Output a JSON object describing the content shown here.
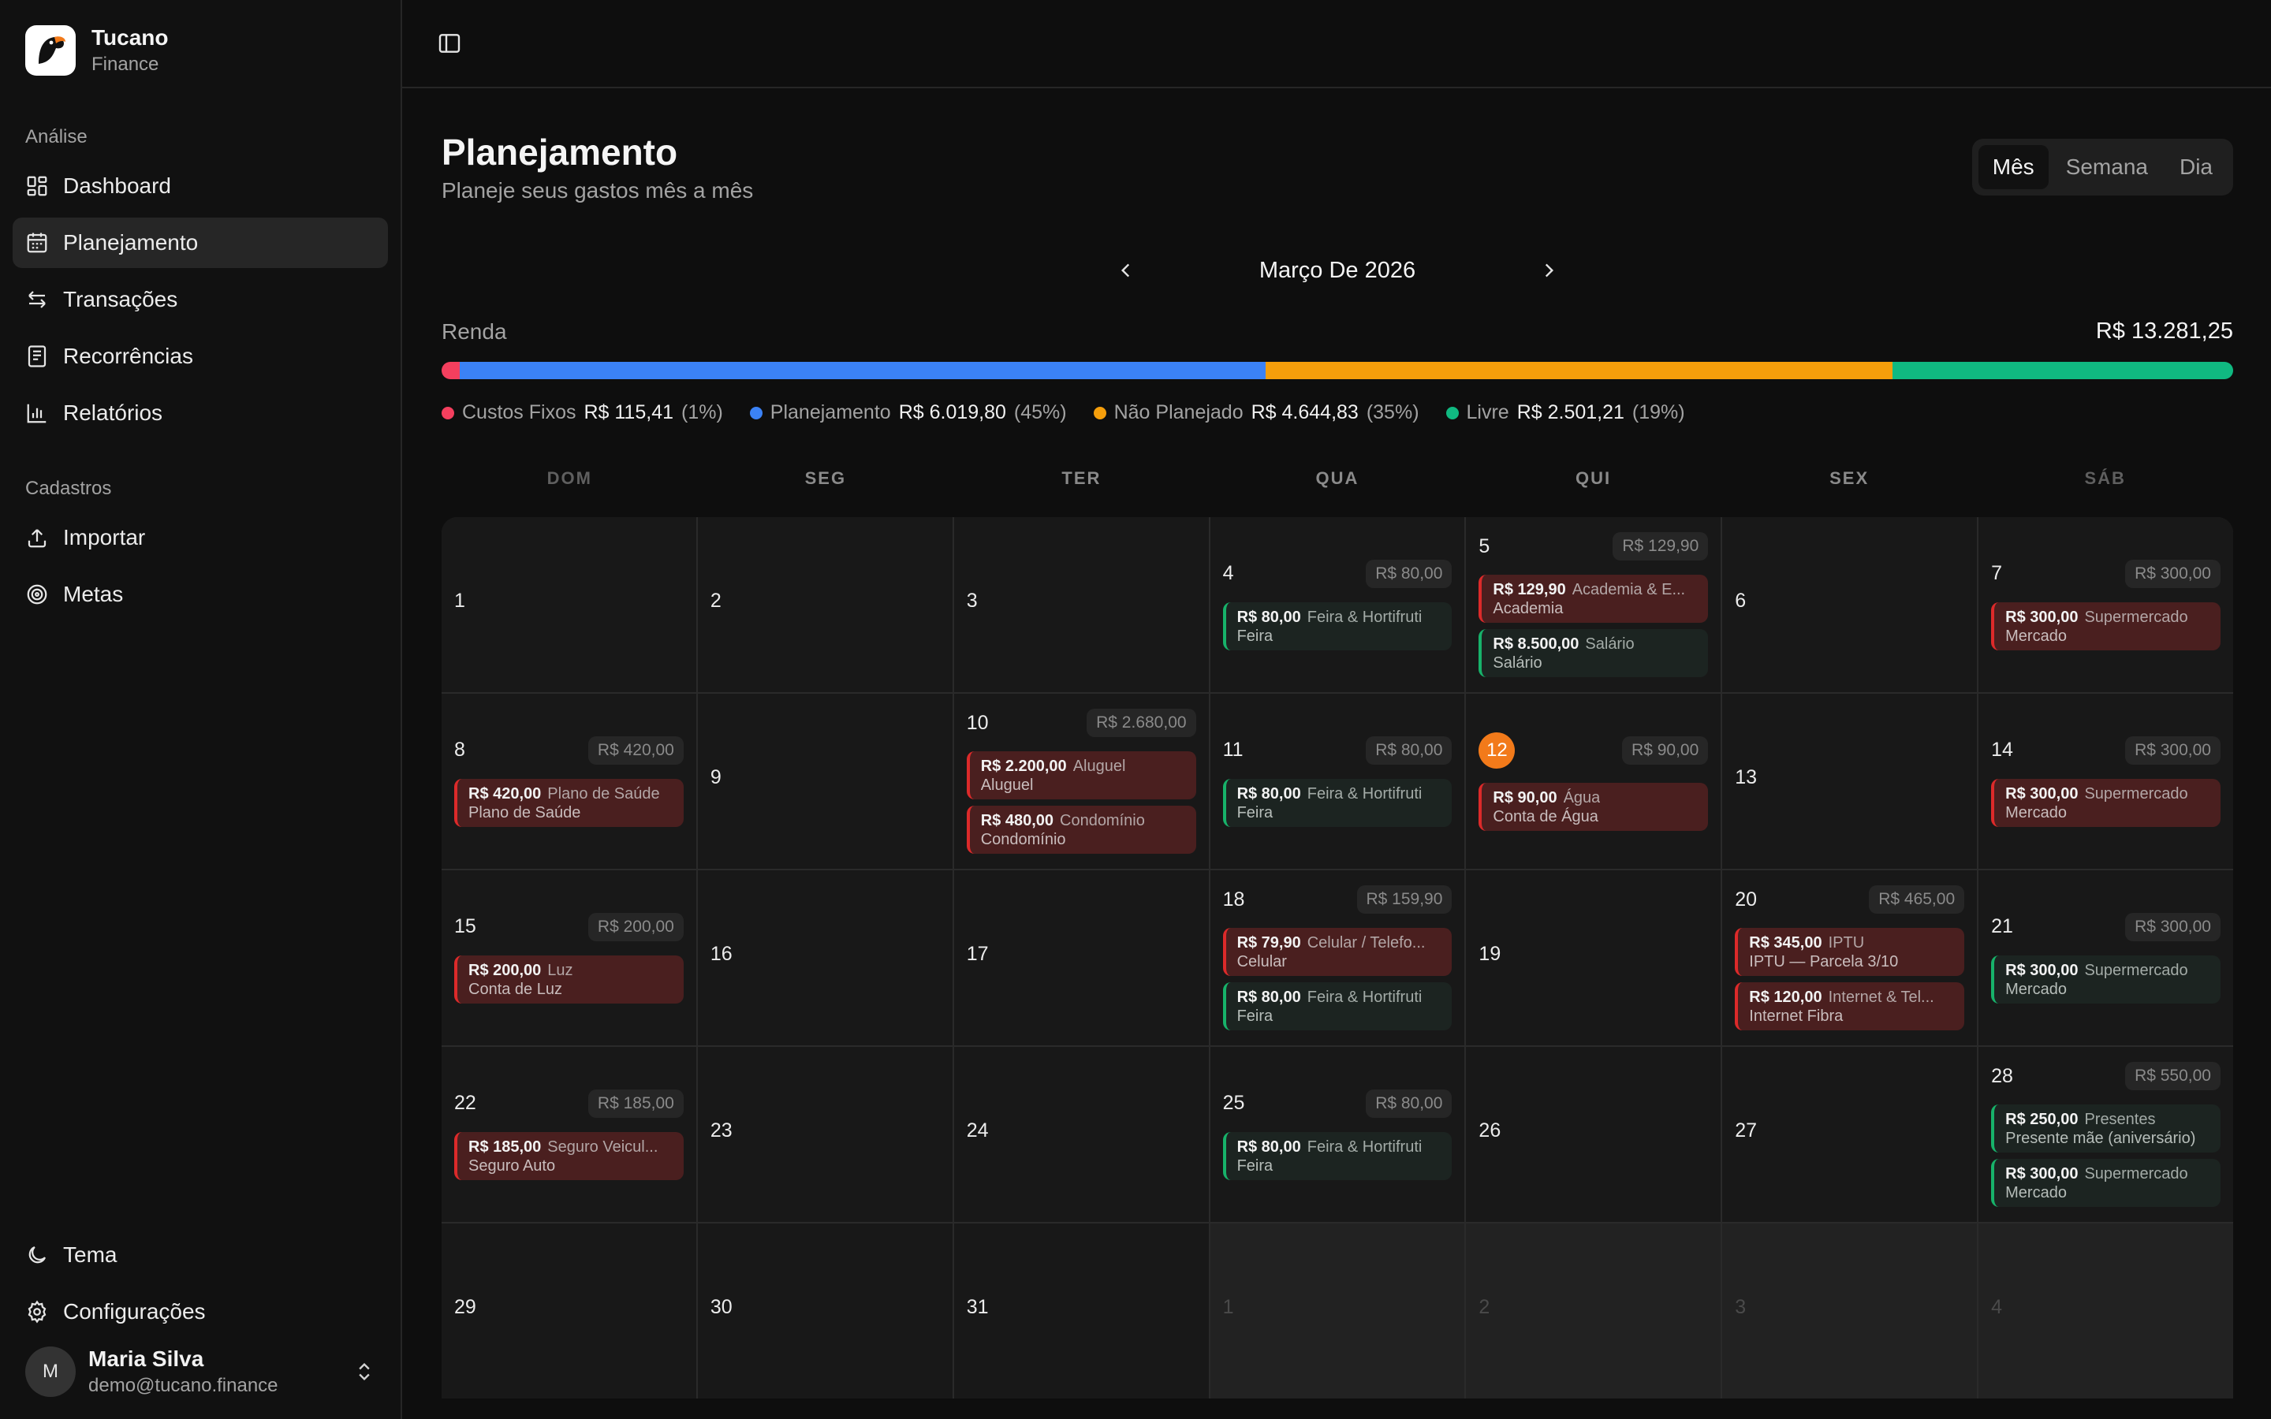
{
  "brand": {
    "name": "Tucano",
    "sub": "Finance"
  },
  "sidebar": {
    "analysis_label": "Análise",
    "analysis_items": [
      {
        "label": "Dashboard",
        "icon": "dashboard-icon"
      },
      {
        "label": "Planejamento",
        "icon": "calendar-icon",
        "active": true
      },
      {
        "label": "Transações",
        "icon": "transfer-arrows-icon"
      },
      {
        "label": "Recorrências",
        "icon": "receipt-icon"
      },
      {
        "label": "Relatórios",
        "icon": "bar-chart-icon"
      }
    ],
    "registry_label": "Cadastros",
    "registry_items": [
      {
        "label": "Importar",
        "icon": "upload-icon"
      },
      {
        "label": "Metas",
        "icon": "target-icon"
      }
    ],
    "bottom_items": [
      {
        "label": "Tema",
        "icon": "moon-icon"
      },
      {
        "label": "Configurações",
        "icon": "gear-icon"
      }
    ],
    "user": {
      "initial": "M",
      "name": "Maria Silva",
      "email": "demo@tucano.finance"
    }
  },
  "page": {
    "title": "Planejamento",
    "subtitle": "Planeje seus gastos mês a mês",
    "views": [
      "Mês",
      "Semana",
      "Dia"
    ],
    "active_view": "Mês",
    "month_label": "Março De 2026"
  },
  "income": {
    "label": "Renda",
    "total": "R$ 13.281,25",
    "segments": [
      {
        "name": "Custos Fixos",
        "value": "R$ 115,41",
        "pct": "(1%)",
        "fraction": 0.01,
        "color": "#f43f5e"
      },
      {
        "name": "Planejamento",
        "value": "R$ 6.019,80",
        "pct": "(45%)",
        "fraction": 0.45,
        "color": "#3b82f6"
      },
      {
        "name": "Não Planejado",
        "value": "R$ 4.644,83",
        "pct": "(35%)",
        "fraction": 0.35,
        "color": "#f59e0b"
      },
      {
        "name": "Livre",
        "value": "R$ 2.501,21",
        "pct": "(19%)",
        "fraction": 0.19,
        "color": "#10b981"
      }
    ]
  },
  "weekdays": [
    "DOM",
    "SEG",
    "TER",
    "QUA",
    "QUI",
    "SEX",
    "SÁB"
  ],
  "calendar": {
    "today": "12",
    "cells": [
      {
        "day": "1"
      },
      {
        "day": "2"
      },
      {
        "day": "3"
      },
      {
        "day": "4",
        "total": "R$ 80,00",
        "events": [
          {
            "amount": "R$ 80,00",
            "category": "Feira & Hortifruti",
            "desc": "Feira",
            "kind": "green"
          }
        ]
      },
      {
        "day": "5",
        "total": "R$ 129,90",
        "events": [
          {
            "amount": "R$ 129,90",
            "category": "Academia & E...",
            "desc": "Academia",
            "kind": "red"
          },
          {
            "amount": "R$ 8.500,00",
            "category": "Salário",
            "desc": "Salário",
            "kind": "green"
          }
        ]
      },
      {
        "day": "6"
      },
      {
        "day": "7",
        "total": "R$ 300,00",
        "events": [
          {
            "amount": "R$ 300,00",
            "category": "Supermercado",
            "desc": "Mercado",
            "kind": "red"
          }
        ]
      },
      {
        "day": "8",
        "total": "R$ 420,00",
        "events": [
          {
            "amount": "R$ 420,00",
            "category": "Plano de Saúde",
            "desc": "Plano de Saúde",
            "kind": "red"
          }
        ]
      },
      {
        "day": "9"
      },
      {
        "day": "10",
        "total": "R$ 2.680,00",
        "events": [
          {
            "amount": "R$ 2.200,00",
            "category": "Aluguel",
            "desc": "Aluguel",
            "kind": "red"
          },
          {
            "amount": "R$ 480,00",
            "category": "Condomínio",
            "desc": "Condomínio",
            "kind": "red"
          }
        ]
      },
      {
        "day": "11",
        "total": "R$ 80,00",
        "events": [
          {
            "amount": "R$ 80,00",
            "category": "Feira & Hortifruti",
            "desc": "Feira",
            "kind": "green"
          }
        ]
      },
      {
        "day": "12",
        "total": "R$ 90,00",
        "events": [
          {
            "amount": "R$ 90,00",
            "category": "Água",
            "desc": "Conta de Água",
            "kind": "red"
          }
        ]
      },
      {
        "day": "13"
      },
      {
        "day": "14",
        "total": "R$ 300,00",
        "events": [
          {
            "amount": "R$ 300,00",
            "category": "Supermercado",
            "desc": "Mercado",
            "kind": "red"
          }
        ]
      },
      {
        "day": "15",
        "total": "R$ 200,00",
        "events": [
          {
            "amount": "R$ 200,00",
            "category": "Luz",
            "desc": "Conta de Luz",
            "kind": "red"
          }
        ]
      },
      {
        "day": "16"
      },
      {
        "day": "17"
      },
      {
        "day": "18",
        "total": "R$ 159,90",
        "events": [
          {
            "amount": "R$ 79,90",
            "category": "Celular / Telefo...",
            "desc": "Celular",
            "kind": "red"
          },
          {
            "amount": "R$ 80,00",
            "category": "Feira & Hortifruti",
            "desc": "Feira",
            "kind": "green"
          }
        ]
      },
      {
        "day": "19"
      },
      {
        "day": "20",
        "total": "R$ 465,00",
        "events": [
          {
            "amount": "R$ 345,00",
            "category": "IPTU",
            "desc": "IPTU — Parcela 3/10",
            "kind": "red"
          },
          {
            "amount": "R$ 120,00",
            "category": "Internet & Tel...",
            "desc": "Internet Fibra",
            "kind": "red"
          }
        ]
      },
      {
        "day": "21",
        "total": "R$ 300,00",
        "events": [
          {
            "amount": "R$ 300,00",
            "category": "Supermercado",
            "desc": "Mercado",
            "kind": "green"
          }
        ]
      },
      {
        "day": "22",
        "total": "R$ 185,00",
        "events": [
          {
            "amount": "R$ 185,00",
            "category": "Seguro Veicul...",
            "desc": "Seguro Auto",
            "kind": "red"
          }
        ]
      },
      {
        "day": "23"
      },
      {
        "day": "24"
      },
      {
        "day": "25",
        "total": "R$ 80,00",
        "events": [
          {
            "amount": "R$ 80,00",
            "category": "Feira & Hortifruti",
            "desc": "Feira",
            "kind": "green"
          }
        ]
      },
      {
        "day": "26"
      },
      {
        "day": "27"
      },
      {
        "day": "28",
        "total": "R$ 550,00",
        "events": [
          {
            "amount": "R$ 250,00",
            "category": "Presentes",
            "desc": "Presente mãe (aniversário)",
            "kind": "green"
          },
          {
            "amount": "R$ 300,00",
            "category": "Supermercado",
            "desc": "Mercado",
            "kind": "green"
          }
        ]
      },
      {
        "day": "29"
      },
      {
        "day": "30"
      },
      {
        "day": "31"
      },
      {
        "day": "1",
        "outside": true
      },
      {
        "day": "2",
        "outside": true
      },
      {
        "day": "3",
        "outside": true
      },
      {
        "day": "4",
        "outside": true
      }
    ]
  }
}
